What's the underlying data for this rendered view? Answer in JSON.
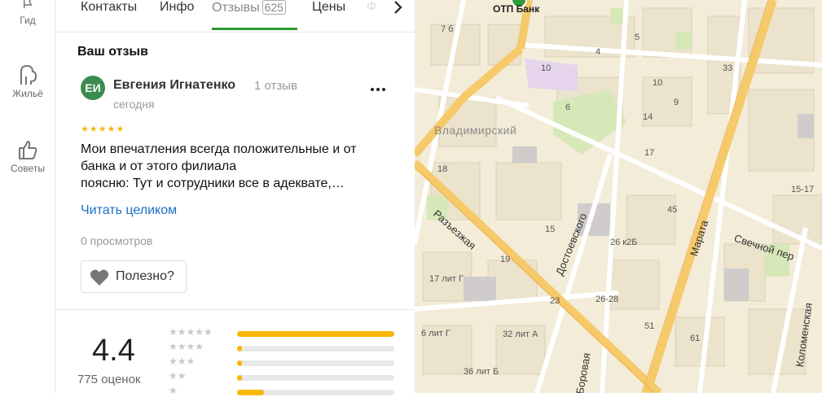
{
  "rail": {
    "items": [
      {
        "label": "Гид",
        "icon": "flag-icon"
      },
      {
        "label": "Жильё",
        "icon": "building-icon"
      },
      {
        "label": "Советы",
        "icon": "thumbs-up-icon"
      }
    ]
  },
  "tabs": {
    "contacts": "Контакты",
    "info": "Инфо",
    "reviews": "Отзывы",
    "reviews_count": "625",
    "prices": "Цены",
    "faded": "Ф"
  },
  "review": {
    "section_title": "Ваш отзыв",
    "avatar_initials": "ЕИ",
    "author": "Евгения Игнатенко",
    "author_reviews": "1 отзыв",
    "date": "сегодня",
    "stars": "★★★★★",
    "text_lines": [
      "Мои впечатления всегда положительные и от",
      "банка и от этого филиала",
      "поясню: Тут и сотрудники все в адеквате,…"
    ],
    "read_more": "Читать целиком",
    "views": "0 просмотров",
    "useful_label": "Полезно?"
  },
  "rating": {
    "value": "4.4",
    "count_label": "775 оценок",
    "distribution": [
      {
        "stars": "★★★★★",
        "fraction": 1.0
      },
      {
        "stars": "★★★★",
        "fraction": 0.03
      },
      {
        "stars": "★★★",
        "fraction": 0.03
      },
      {
        "stars": "★★",
        "fraction": 0.03
      },
      {
        "stars": "★",
        "fraction": 0.17
      }
    ]
  },
  "map": {
    "poi": "ОТП Банк",
    "district": "Владимирский",
    "streets": [
      "Разъезжая",
      "Достоевского",
      "Марата",
      "Свечной пер",
      "Коломенская",
      "Боровая"
    ],
    "houses": [
      "7 б",
      "4",
      "5",
      "10",
      "10",
      "6",
      "33",
      "9",
      "14",
      "17",
      "18",
      "45",
      "15-17",
      "15",
      "26 к2Б",
      "19",
      "17 лит Г",
      "23",
      "26-28",
      "51",
      "6 лит Г",
      "32 лит А",
      "36 лит Б",
      "61",
      "7 Б"
    ]
  },
  "colors": {
    "accent_green": "#2d9b2d",
    "link_blue": "#1a6fc6",
    "star_yellow": "#f9b700",
    "avatar_green": "#3b8a4f"
  }
}
